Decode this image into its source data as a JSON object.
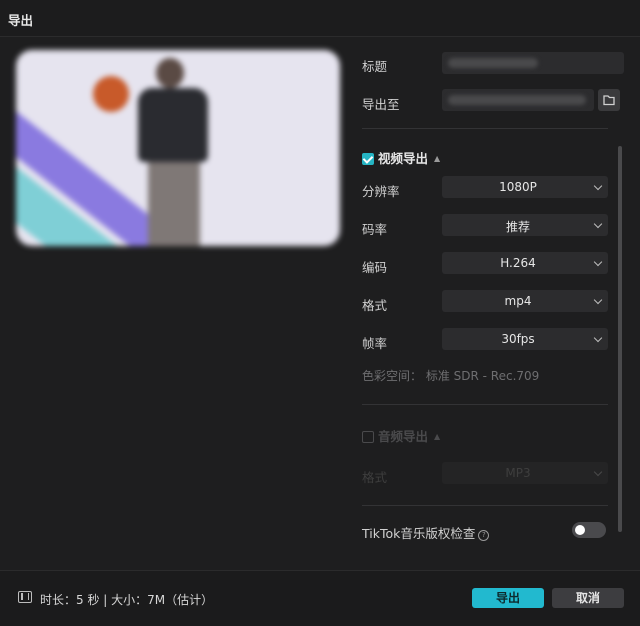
{
  "window": {
    "title": "导出"
  },
  "form": {
    "title_label": "标题",
    "export_to_label": "导出至"
  },
  "video": {
    "section_label": "视频导出",
    "enabled": true,
    "rows": [
      {
        "label": "分辨率",
        "value": "1080P"
      },
      {
        "label": "码率",
        "value": "推荐"
      },
      {
        "label": "编码",
        "value": "H.264"
      },
      {
        "label": "格式",
        "value": "mp4"
      },
      {
        "label": "帧率",
        "value": "30fps"
      }
    ],
    "color_space": "色彩空间： 标准 SDR - Rec.709"
  },
  "audio": {
    "section_label": "音频导出",
    "enabled": false,
    "format_label": "格式",
    "format_value": "MP3"
  },
  "tiktok": {
    "label": "TikTok音乐版权检查",
    "help_icon": "?",
    "enabled": false
  },
  "footer": {
    "info": "时长：5 秒 | 大小：7M（估计）",
    "export_button": "导出",
    "cancel_button": "取消"
  },
  "colors": {
    "accent": "#22b9cf",
    "background": "#1e1e1f",
    "field": "#2c2c2e"
  }
}
